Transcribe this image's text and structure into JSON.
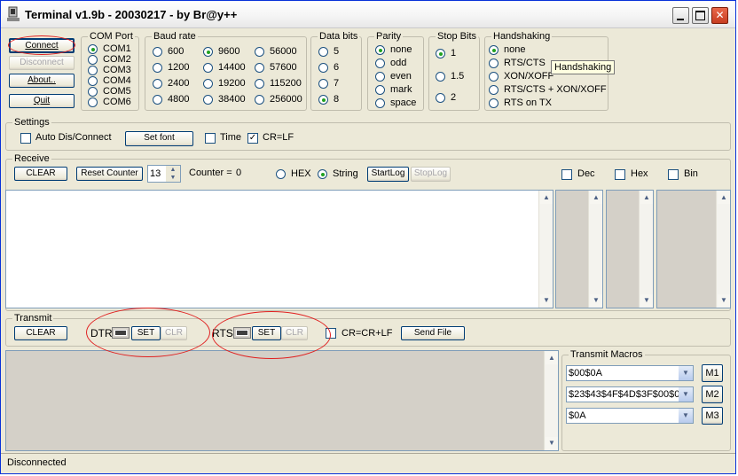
{
  "title": "Terminal v1.9b - 20030217 - by Br@y++",
  "conn": {
    "connect": "Connect",
    "disconnect": "Disconnect",
    "about": "About..",
    "quit": "Quit"
  },
  "comport": {
    "label": "COM Port",
    "items": [
      "COM1",
      "COM2",
      "COM3",
      "COM4",
      "COM5",
      "COM6"
    ],
    "selected": "COM1"
  },
  "baud": {
    "label": "Baud rate",
    "items": [
      "600",
      "1200",
      "2400",
      "4800",
      "9600",
      "14400",
      "19200",
      "38400",
      "56000",
      "57600",
      "115200",
      "256000"
    ],
    "selected": "9600"
  },
  "databits": {
    "label": "Data bits",
    "items": [
      "5",
      "6",
      "7",
      "8"
    ],
    "selected": "8"
  },
  "parity": {
    "label": "Parity",
    "items": [
      "none",
      "odd",
      "even",
      "mark",
      "space"
    ],
    "selected": "none"
  },
  "stopbits": {
    "label": "Stop Bits",
    "items": [
      "1",
      "1.5",
      "2"
    ],
    "selected": "1"
  },
  "handshaking": {
    "label": "Handshaking",
    "items": [
      "none",
      "RTS/CTS",
      "XON/XOFF",
      "RTS/CTS + XON/XOFF",
      "RTS on TX"
    ],
    "selected": "none",
    "tooltip": "Handshaking"
  },
  "settings": {
    "label": "Settings",
    "auto": "Auto Dis/Connect",
    "auto_checked": false,
    "setfont": "Set font",
    "time": "Time",
    "time_checked": false,
    "crlf": "CR=LF",
    "crlf_checked": true
  },
  "receive": {
    "label": "Receive",
    "clear": "CLEAR",
    "reset_counter": "Reset Counter",
    "counter_spin": "13",
    "counter_label": "Counter =",
    "counter_value": "0",
    "hex": "HEX",
    "string": "String",
    "mode_selected": "String",
    "startlog": "StartLog",
    "stoplog": "StopLog",
    "dec": "Dec",
    "hex_cb": "Hex",
    "bin": "Bin"
  },
  "transmit": {
    "label": "Transmit",
    "clear": "CLEAR",
    "dtr": "DTR",
    "rts": "RTS",
    "set": "SET",
    "clr": "CLR",
    "crcrlf": "CR=CR+LF",
    "crcrlf_checked": false,
    "sendfile": "Send File"
  },
  "macros": {
    "label": "Transmit Macros",
    "items": [
      {
        "value": "$00$0A",
        "btn": "M1"
      },
      {
        "value": "$23$43$4F$4D$3F$00$0",
        "btn": "M2"
      },
      {
        "value": "$0A",
        "btn": "M3"
      }
    ]
  },
  "status": {
    "text": "Disconnected"
  },
  "colors": {
    "title_bar": "#f4f4f4",
    "window_bg": "#ece9d8",
    "annotation": "#e02020",
    "receive_bg": "#d4d0c8",
    "transmit_bg": "#d4d0c8"
  }
}
